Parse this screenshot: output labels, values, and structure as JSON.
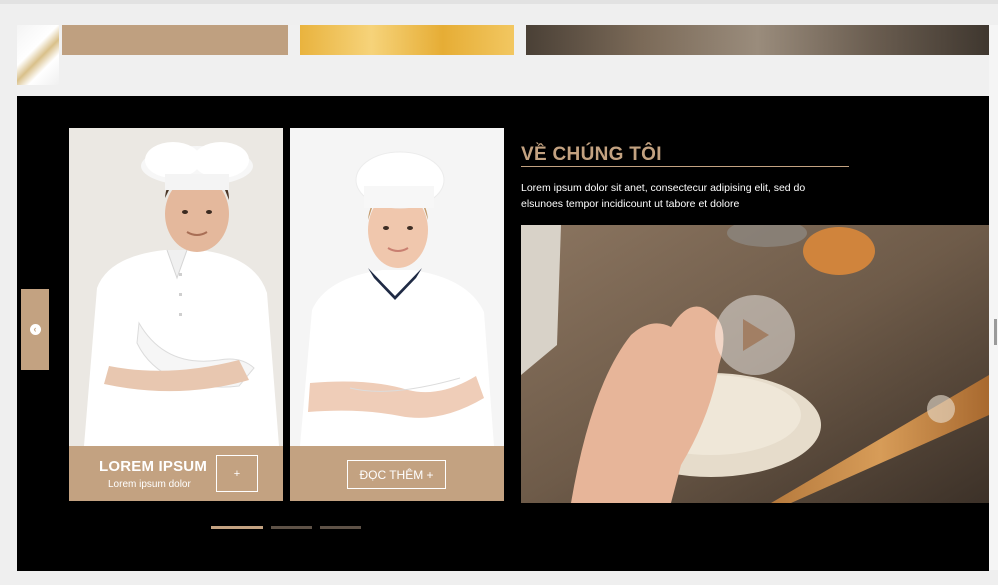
{
  "top_gallery": {
    "tiles": [
      "beige-tile",
      "gold-tile",
      "stone-tile"
    ]
  },
  "slider": {
    "prev_icon": "chevron-left-icon",
    "cards": [
      {
        "title": "LOREM IPSUM",
        "subtitle": "Lorem ipsum dolor",
        "plus_label": "+"
      },
      {
        "button_label": "ĐỌC THÊM +"
      }
    ],
    "dots": [
      "slide-1",
      "slide-2",
      "slide-3"
    ],
    "active_dot": 0
  },
  "about": {
    "title": "VỀ CHÚNG TÔI",
    "description": "Lorem ipsum dolor sit anet, consectecur adipising elit, sed do elsunoes tempor incidicount ut tabore et dolore",
    "video_icon": "play-icon"
  },
  "colors": {
    "accent": "#c3a281",
    "background_dark": "#000000",
    "page": "#efefef"
  }
}
